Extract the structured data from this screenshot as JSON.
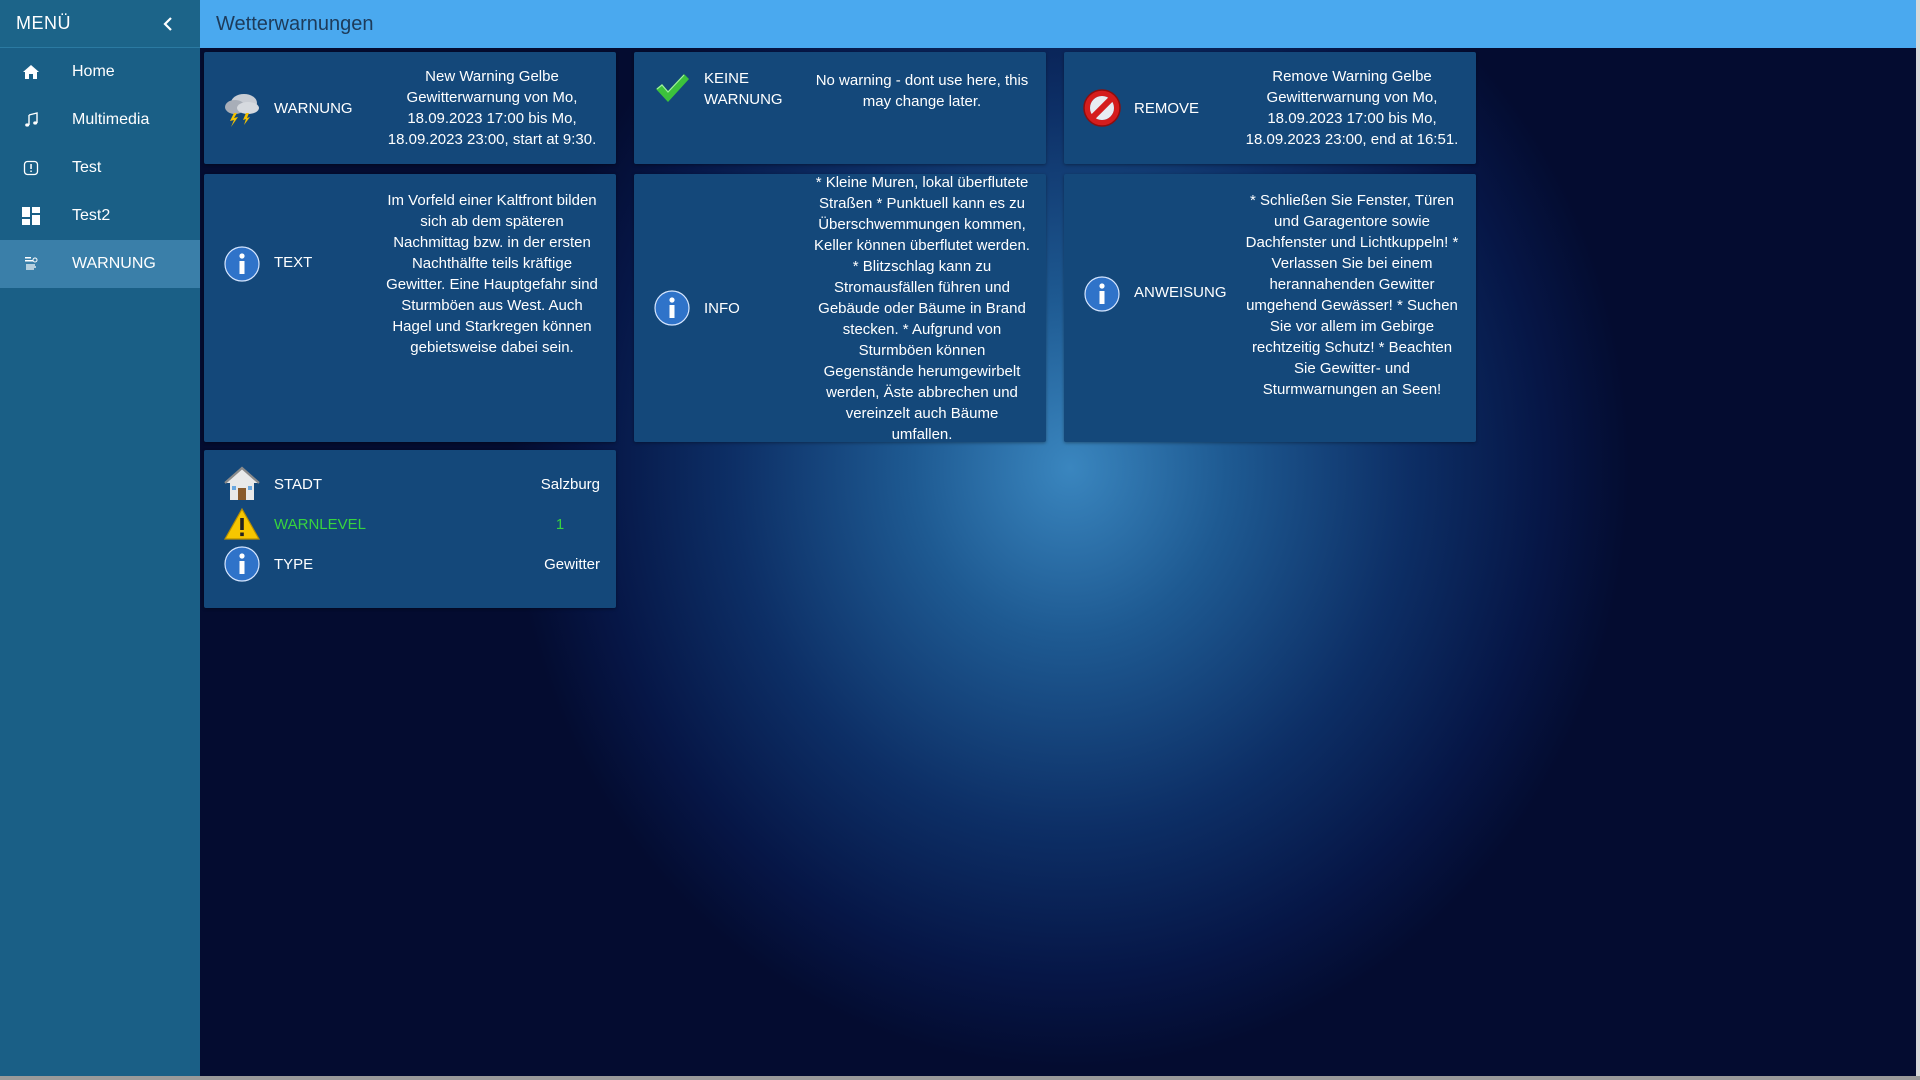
{
  "sidebar": {
    "title": "MENÜ",
    "collapse_icon": "chevron-left-icon",
    "items": [
      {
        "label": "Home",
        "icon": "home-icon"
      },
      {
        "label": "Multimedia",
        "icon": "music-note-icon"
      },
      {
        "label": "Test",
        "icon": "info-square-icon"
      },
      {
        "label": "Test2",
        "icon": "dashboard-grid-icon"
      },
      {
        "label": "WARNUNG",
        "icon": "weather-alert-icon",
        "active": true
      }
    ]
  },
  "header": {
    "title": "Wetterwarnungen"
  },
  "colors": {
    "sidebar": "#1a5f86",
    "topbar": "#4aa9ef",
    "card": "#14487a",
    "active_item": "#3a7fa9",
    "warnlevel": "#37d43e"
  },
  "cards": {
    "warnung": {
      "label": "WARNUNG",
      "icon": "thunderstorm-cloud-icon",
      "value": "New Warning Gelbe Gewitterwarnung von Mo, 18.09.2023 17:00 bis Mo, 18.09.2023 23:00, start at 9:30."
    },
    "keine_warnung": {
      "label": "KEINE WARNUNG",
      "icon": "checkmark-icon",
      "value": "No warning - dont use here, this may change later."
    },
    "remove": {
      "label": "REMOVE",
      "icon": "prohibited-icon",
      "value": "Remove Warning Gelbe Gewitterwarnung von Mo, 18.09.2023 17:00 bis Mo, 18.09.2023 23:00, end at 16:51."
    },
    "text": {
      "label": "TEXT",
      "icon": "info-icon",
      "value": "Im Vorfeld einer Kaltfront bilden sich ab dem späteren Nachmittag bzw. in der ersten Nachthälfte teils kräftige Gewitter. Eine Hauptgefahr sind Sturmböen aus West. Auch Hagel und Starkregen können gebietsweise dabei sein."
    },
    "info": {
      "label": "INFO",
      "icon": "info-icon",
      "value": "* Kleine Muren, lokal überflutete Straßen * Punktuell kann es zu Überschwemmungen kommen, Keller können überflutet werden. * Blitzschlag kann zu Stromausfällen führen und Gebäude oder Bäume in Brand stecken. * Aufgrund von Sturmböen können Gegenstände herumgewirbelt werden, Äste abbrechen und vereinzelt auch Bäume umfallen."
    },
    "anweisung": {
      "label": "ANWEISUNG",
      "icon": "info-icon",
      "value": "* Schließen Sie Fenster, Türen und Garagentore sowie Dachfenster und Lichtkuppeln! * Verlassen Sie bei einem herannahenden Gewitter umgehend Gewässer! * Suchen Sie vor allem im Gebirge rechtzeitig Schutz! * Beachten Sie Gewitter- und Sturmwarnungen an Seen!"
    },
    "details": {
      "rows": [
        {
          "label": "STADT",
          "value": "Salzburg",
          "icon": "house-icon"
        },
        {
          "label": "WARNLEVEL",
          "value": "1",
          "icon": "warning-triangle-icon"
        },
        {
          "label": "TYPE",
          "value": "Gewitter",
          "icon": "info-icon"
        }
      ]
    }
  }
}
